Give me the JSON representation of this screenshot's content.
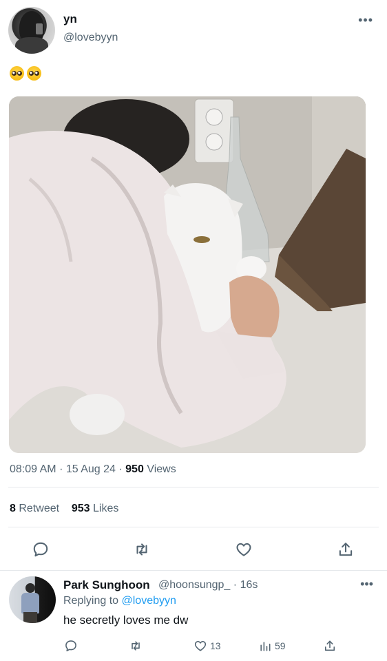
{
  "tweet": {
    "display_name": "yn",
    "handle": "@lovebyyn",
    "text_emojis": [
      "pleading-face-emoji",
      "pleading-face-emoji"
    ],
    "image_alt": "person resting head on a white cat on a countertop",
    "time": "08:09 AM",
    "date": "15 Aug 24",
    "views_count": "950",
    "views_label": "Views",
    "retweet_count": "8",
    "retweet_label": "Retweet",
    "likes_count": "953",
    "likes_label": "Likes",
    "more_glyph": "•••",
    "sep": "·"
  },
  "actions": {
    "icons": [
      "reply-icon",
      "retweet-icon",
      "like-icon",
      "share-icon"
    ]
  },
  "reply": {
    "display_name": "Park Sunghoon",
    "handle": "@hoonsungp_",
    "time": "16s",
    "replying_label": "Replying to",
    "replying_to": "@lovebyyn",
    "text": "he secretly loves me dw",
    "like_count": "13",
    "views_count": "59",
    "more_glyph": "•••",
    "sep": "·"
  },
  "colors": {
    "text": "#0f1419",
    "muted": "#536471",
    "accent": "#1d9bf0",
    "divider": "#e6e9ec"
  }
}
